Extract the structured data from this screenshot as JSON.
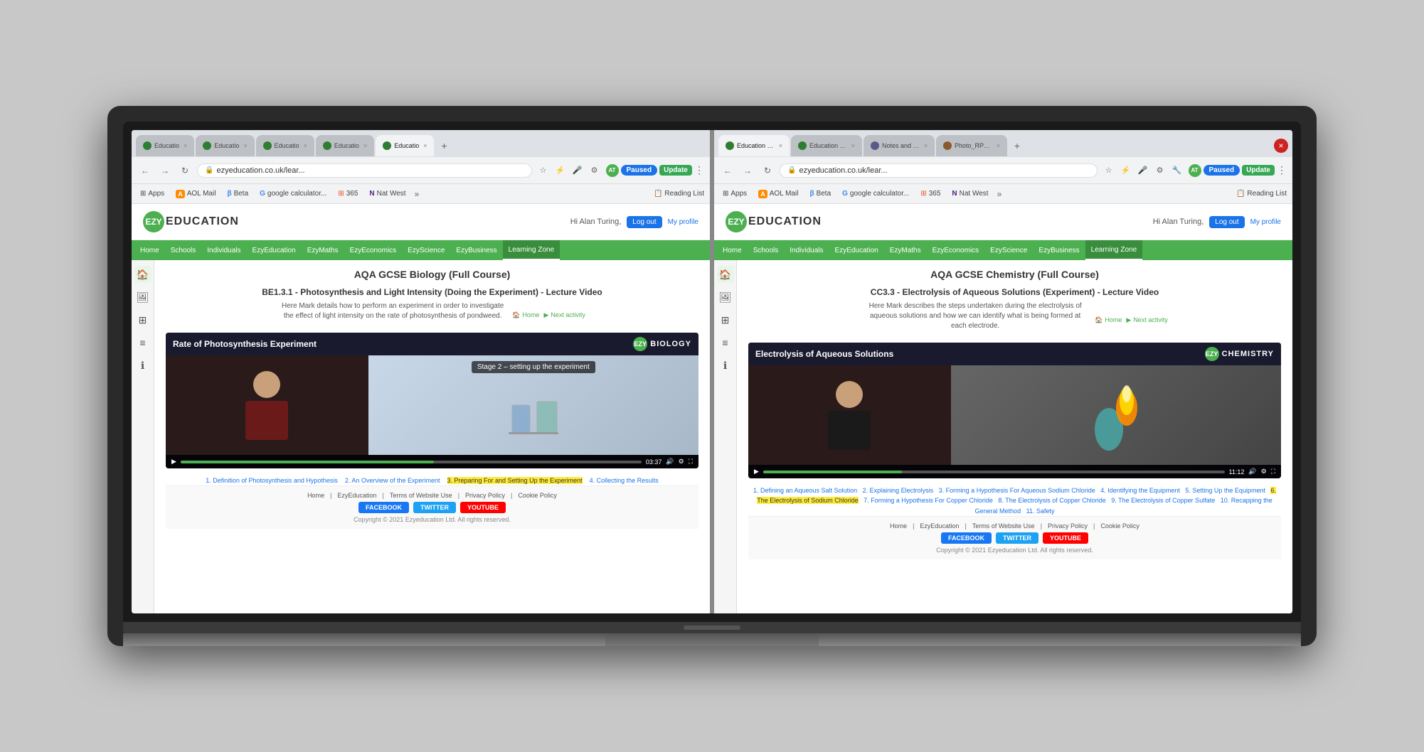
{
  "laptop": {
    "left_browser": {
      "tabs": [
        {
          "label": "Educatio",
          "active": false,
          "favicon": "ezy"
        },
        {
          "label": "Educatio",
          "active": false,
          "favicon": "ezy"
        },
        {
          "label": "Educatio",
          "active": false,
          "favicon": "ezy"
        },
        {
          "label": "Educatio",
          "active": false,
          "favicon": "ezy"
        },
        {
          "label": "Educatio",
          "active": true,
          "favicon": "ezy"
        }
      ],
      "address": "ezyeducation.co.uk/lear...",
      "paused_label": "Paused",
      "update_label": "Update",
      "bookmarks": [
        "Apps",
        "AOL Mail",
        "Beta",
        "google calculator...",
        "365",
        "Nat West"
      ],
      "reading_list": "Reading List",
      "site": {
        "logo_text": "EZY",
        "site_name": "EDUCATION",
        "greeting": "Hi Alan Turing,",
        "logout_label": "Log out",
        "my_profile": "My profile",
        "nav_items": [
          "Home",
          "Schools",
          "Individuals",
          "EzyEducation",
          "EzyMaths",
          "EzyEconomics",
          "EzyScience",
          "EzyBusiness",
          "Learning Zone"
        ],
        "active_nav": "Learning Zone",
        "course_title": "AQA GCSE Biology (Full Course)",
        "lecture_title": "BE1.3.1 - Photosynthesis and Light Intensity (Doing the Experiment) - Lecture Video",
        "lecture_desc": "Here Mark details how to perform an experiment in order to investigate the effect of light intensity on the rate of photosynthesis of pondweed.",
        "home_link": "Home",
        "next_activity": "Next activity",
        "video_title": "Rate of Photosynthesis Experiment",
        "video_badge_text": "EZY",
        "video_subject": "BIOLOGY",
        "stage_label": "Stage 2 – setting up the experiment",
        "video_time": "03:37",
        "chapters": [
          {
            "num": "1.",
            "label": "Definition of Photosynthesis and Hypothesis",
            "active": false
          },
          {
            "num": "2.",
            "label": "An Overview of the Experiment",
            "active": false
          },
          {
            "num": "3.",
            "label": "Preparing For and Setting Up the Experiment",
            "active": true
          },
          {
            "num": "4.",
            "label": "Collecting the Results",
            "active": false
          }
        ],
        "footer_links": [
          "Home",
          "EzyEducation",
          "Terms of Website Use",
          "Privacy Policy",
          "Cookie Policy"
        ],
        "social": {
          "facebook": "FACEBOOK",
          "twitter": "TWITTER",
          "youtube": "YOUTUBE"
        },
        "copyright": "Copyright © 2021 Ezyeducation Ltd. All rights reserved."
      }
    },
    "right_browser": {
      "tabs": [
        {
          "label": "Education res",
          "active": false,
          "favicon": "ezy"
        },
        {
          "label": "Education res",
          "active": false,
          "favicon": "ezy"
        },
        {
          "label": "Notes and W...",
          "active": false,
          "favicon": "notes"
        },
        {
          "label": "Photo_RP_INF...",
          "active": false,
          "favicon": "photo"
        }
      ],
      "address": "ezyeducation.co.uk/lear...",
      "paused_label": "Paused",
      "update_label": "Update",
      "bookmarks": [
        "Apps",
        "AOL Mail",
        "Beta",
        "google calculator...",
        "365",
        "Nat West"
      ],
      "reading_list": "Reading List",
      "site": {
        "logo_text": "EZY",
        "site_name": "EDUCATION",
        "greeting": "Hi Alan Turing,",
        "logout_label": "Log out",
        "my_profile": "My profile",
        "nav_items": [
          "Home",
          "Schools",
          "Individuals",
          "EzyEducation",
          "EzyMaths",
          "EzyEconomics",
          "EzyScience",
          "EzyBusiness",
          "Learning Zone"
        ],
        "active_nav": "Learning Zone",
        "course_title": "AQA GCSE Chemistry (Full Course)",
        "lecture_title": "CC3.3 - Electrolysis of Aqueous Solutions (Experiment) - Lecture Video",
        "lecture_desc": "Here Mark describes the steps undertaken during the electrolysis of aqueous solutions and how we can identify what is being formed at each electrode.",
        "home_link": "Home",
        "next_activity": "Next activity",
        "video_title": "Electrolysis of Aqueous Solutions",
        "video_badge_text": "EZY",
        "video_subject": "CHEMISTRY",
        "video_time": "11:12",
        "chapters": [
          {
            "num": "1.",
            "label": "Defining an Aqueous Salt Solution",
            "active": false
          },
          {
            "num": "2.",
            "label": "Explaining Electrolysis",
            "active": false
          },
          {
            "num": "3.",
            "label": "Forming a Hypothesis For Aqueous Sodium Chloride",
            "active": false
          },
          {
            "num": "4.",
            "label": "Identifying the Equipment",
            "active": false
          },
          {
            "num": "5.",
            "label": "Setting Up the Equipment",
            "active": false
          },
          {
            "num": "6.",
            "label": "The Electrolysis of Sodium Chloride",
            "active": true
          },
          {
            "num": "7.",
            "label": "Forming a Hypothesis For Copper Chloride",
            "active": false
          },
          {
            "num": "8.",
            "label": "The Electrolysis of Copper Chloride",
            "active": false
          },
          {
            "num": "9.",
            "label": "The Electrolysis of Copper Sulfate",
            "active": false
          },
          {
            "num": "10.",
            "label": "Recapping the General Method",
            "active": false
          },
          {
            "num": "11.",
            "label": "Safety",
            "active": false
          }
        ],
        "footer_links": [
          "Home",
          "EzyEducation",
          "Terms of Website Use",
          "Privacy Policy",
          "Cookie Policy"
        ],
        "social": {
          "facebook": "FACEBOOK",
          "twitter": "TWITTER",
          "youtube": "YOUTUBE"
        },
        "copyright": "Copyright © 2021 Ezyeducation Ltd. All rights reserved."
      }
    }
  }
}
